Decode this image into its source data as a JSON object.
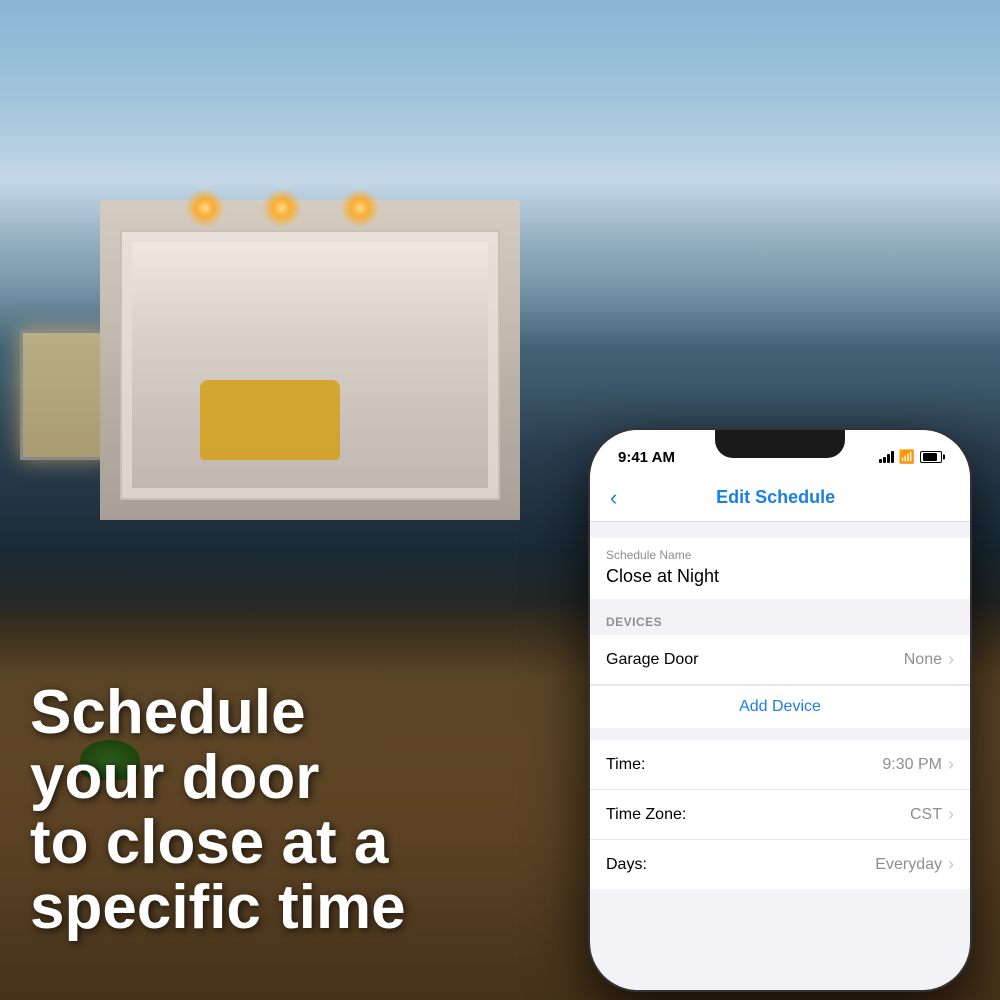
{
  "background": {
    "alt": "House with garage door open at night with warm lighting"
  },
  "hero": {
    "line1": "Schedule",
    "line2": "your door",
    "line3": "to close at a",
    "line4": "specific time"
  },
  "phone": {
    "status_bar": {
      "time": "9:41 AM",
      "signal": "●●●",
      "wifi": "WiFi",
      "battery": "Battery"
    },
    "nav": {
      "back_label": "‹",
      "title": "Edit Schedule"
    },
    "schedule_name_label": "Schedule Name",
    "schedule_name_value": "Close at Night",
    "devices_section_header": "DEVICES",
    "devices": [
      {
        "label": "Garage Door",
        "value": "None"
      }
    ],
    "add_device_label": "Add Device",
    "settings": [
      {
        "label": "Time:",
        "value": "9:30 PM"
      },
      {
        "label": "Time Zone:",
        "value": "CST"
      },
      {
        "label": "Days:",
        "value": "Everyday"
      }
    ]
  },
  "colors": {
    "accent_blue": "#1a7fe8",
    "text_primary": "#000000",
    "text_secondary": "#8e8e93",
    "background_light": "#f2f2f7",
    "white": "#ffffff",
    "divider": "#e8e8ea"
  }
}
